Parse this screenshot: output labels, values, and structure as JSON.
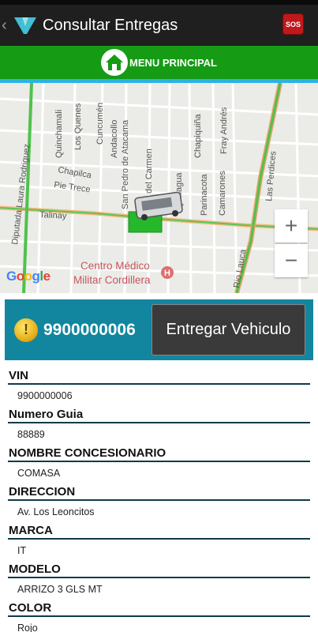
{
  "appbar": {
    "back_icon": "chevron-left-icon",
    "logo_icon": "app-logo-icon",
    "title": "Consultar Entregas",
    "sos_label": "SOS",
    "sos_color": "#c0181b"
  },
  "menu": {
    "home_icon": "home-icon",
    "label": "MENU PRINCIPAL",
    "color": "#159b14"
  },
  "map": {
    "streets": [
      "Quinchamali",
      "Los Quenes",
      "Cuncumén",
      "Andacollo",
      "San Pedro de Atacama",
      "Mar del Carmen",
      "Quillagua",
      "Chapiquiña",
      "Fray Andrés",
      "Chapilca",
      "Pie Trece",
      "Talinay",
      "Diputada Laura Rodriguez",
      "Parinacota",
      "Camarones",
      "Las Perdices",
      "Rio Lauca"
    ],
    "poi": "Centro Médico Militar Cordillera",
    "attribution": "Google",
    "zoom_in_label": "+",
    "zoom_out_label": "−"
  },
  "vehicle": {
    "status_icon": "warning-coin-icon",
    "status_glyph": "!",
    "vin": "9900000006",
    "deliver_label": "Entregar Vehiculo",
    "panel_color": "#13869f"
  },
  "details": [
    {
      "label": "VIN",
      "value": "9900000006"
    },
    {
      "label": "Numero Guia",
      "value": "88889"
    },
    {
      "label": "NOMBRE CONCESIONARIO",
      "value": "COMASA"
    },
    {
      "label": "DIRECCION",
      "value": "Av. Los Leoncitos"
    },
    {
      "label": "MARCA",
      "value": "IT"
    },
    {
      "label": "MODELO",
      "value": "ARRIZO 3 GLS MT"
    },
    {
      "label": "COLOR",
      "value": "Rojo"
    }
  ]
}
